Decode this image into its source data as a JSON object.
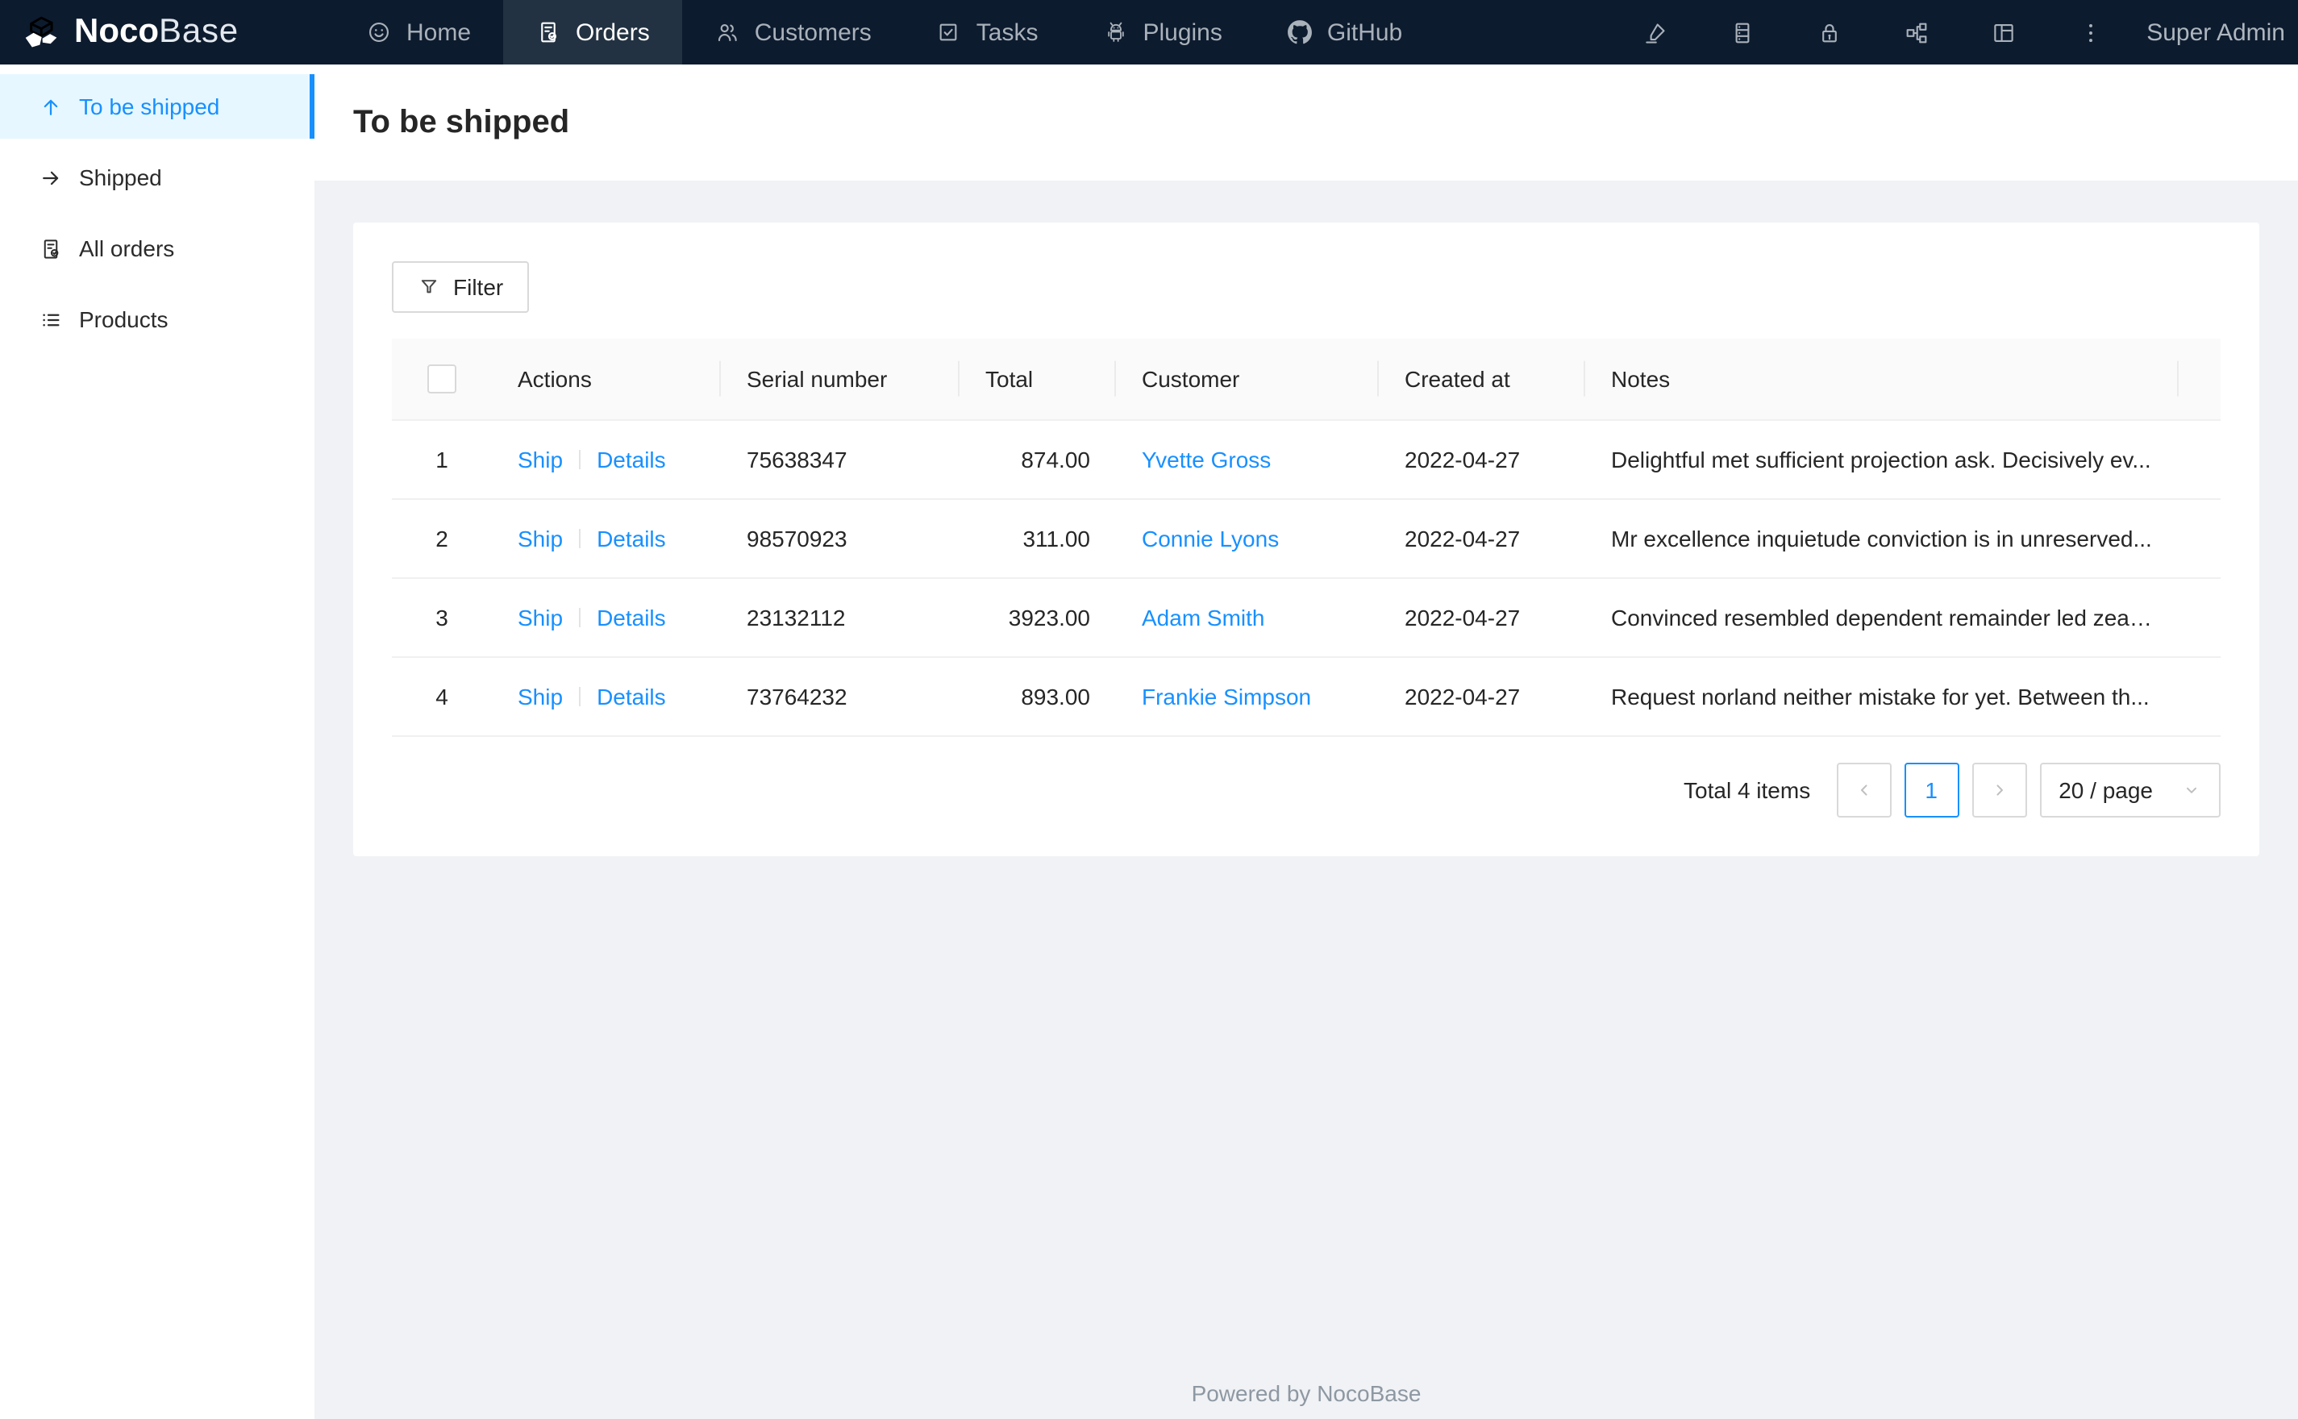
{
  "navbar": {
    "logo": {
      "icon": "nocobase-logo-icon",
      "bold": "Noco",
      "light": "Base"
    },
    "items": [
      {
        "label": "Home",
        "icon": "home-icon",
        "active": false
      },
      {
        "label": "Orders",
        "icon": "orders-icon",
        "active": true
      },
      {
        "label": "Customers",
        "icon": "customers-icon",
        "active": false
      },
      {
        "label": "Tasks",
        "icon": "tasks-icon",
        "active": false
      },
      {
        "label": "Plugins",
        "icon": "plugins-icon",
        "active": false
      },
      {
        "label": "GitHub",
        "icon": "github-icon",
        "active": false
      }
    ],
    "right_icons": [
      "highlight-icon",
      "database-icon",
      "lock-icon",
      "partition-icon",
      "layout-icon",
      "more-icon"
    ],
    "user": "Super Admin"
  },
  "sidebar": {
    "items": [
      {
        "label": "To be shipped",
        "icon": "arrow-up-icon",
        "active": true
      },
      {
        "label": "Shipped",
        "icon": "arrow-right-icon",
        "active": false
      },
      {
        "label": "All orders",
        "icon": "file-done-icon",
        "active": false
      },
      {
        "label": "Products",
        "icon": "list-icon",
        "active": false
      }
    ]
  },
  "page": {
    "title": "To be shipped"
  },
  "toolbar": {
    "filter": {
      "label": "Filter",
      "icon": "filter-icon"
    }
  },
  "table": {
    "columns": [
      {
        "id": "actions",
        "label": "Actions"
      },
      {
        "id": "serial",
        "label": "Serial number"
      },
      {
        "id": "total",
        "label": "Total",
        "align": "right"
      },
      {
        "id": "customer",
        "label": "Customer",
        "link": true
      },
      {
        "id": "created",
        "label": "Created at"
      },
      {
        "id": "notes",
        "label": "Notes"
      }
    ],
    "rows": [
      {
        "index": "1",
        "actions": [
          "Ship",
          "Details"
        ],
        "serial": "75638347",
        "total": "874.00",
        "customer": "Yvette Gross",
        "created": "2022-04-27",
        "notes": "Delightful met sufficient projection ask. Decisively ev..."
      },
      {
        "index": "2",
        "actions": [
          "Ship",
          "Details"
        ],
        "serial": "98570923",
        "total": "311.00",
        "customer": "Connie Lyons",
        "created": "2022-04-27",
        "notes": "Mr excellence inquietude conviction is in unreserved..."
      },
      {
        "index": "3",
        "actions": [
          "Ship",
          "Details"
        ],
        "serial": "23132112",
        "total": "3923.00",
        "customer": "Adam Smith",
        "created": "2022-04-27",
        "notes": "Convinced resembled dependent remainder led zeal..."
      },
      {
        "index": "4",
        "actions": [
          "Ship",
          "Details"
        ],
        "serial": "73764232",
        "total": "893.00",
        "customer": "Frankie Simpson",
        "created": "2022-04-27",
        "notes": "Request norland neither mistake for yet. Between th..."
      }
    ]
  },
  "pagination": {
    "total_text": "Total 4 items",
    "prev_icon": "chevron-left-icon",
    "current": "1",
    "next_icon": "chevron-right-icon",
    "page_size": "20 / page",
    "page_size_icon": "chevron-down-icon"
  },
  "footer": {
    "text": "Powered by NocoBase"
  },
  "colors": {
    "accent": "#1890ff",
    "navbar_bg": "#0d1b2e",
    "navbar_active_bg": "#233242",
    "sidebar_active_bg": "#e6f7ff",
    "content_bg": "#f0f2f5",
    "table_header_bg": "#fafafa",
    "table_border": "#f0f0f0"
  }
}
